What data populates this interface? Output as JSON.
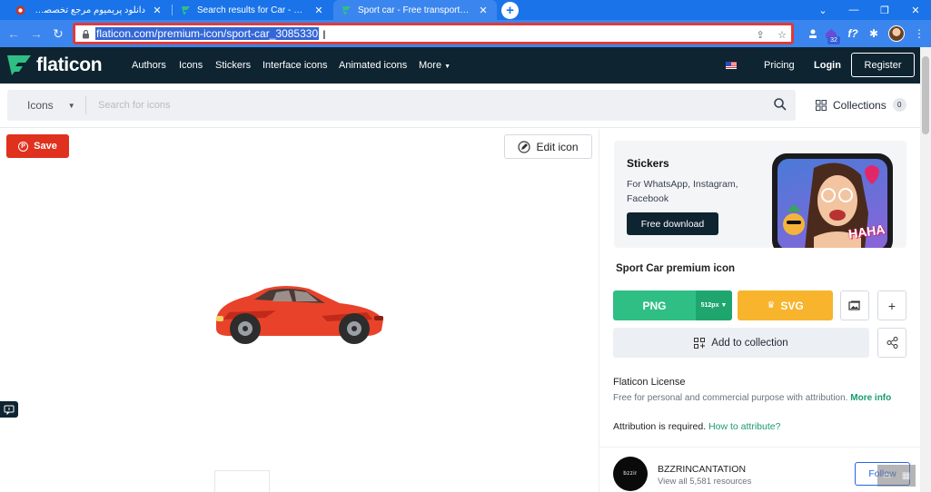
{
  "browser": {
    "tabs": [
      {
        "title": "دانلود پریمیوم مرجع تخصصی دانلود",
        "active": false
      },
      {
        "title": "Search results for Car - Flaticon",
        "active": false
      },
      {
        "title": "Sport car - Free transport icons",
        "active": true
      }
    ],
    "url": "flaticon.com/premium-icon/sport-car_3085330",
    "extension_badge": "32"
  },
  "header": {
    "logo_text": "flaticon",
    "nav": [
      "Authors",
      "Icons",
      "Stickers",
      "Interface icons",
      "Animated icons",
      "More"
    ],
    "pricing": "Pricing",
    "login": "Login",
    "register": "Register"
  },
  "search": {
    "type": "Icons",
    "placeholder": "Search for icons",
    "collections_label": "Collections",
    "collections_count": "0"
  },
  "left": {
    "save": "Save",
    "edit_icon": "Edit icon"
  },
  "promo": {
    "title": "Stickers",
    "desc": "For WhatsApp, Instagram, Facebook",
    "button": "Free download",
    "sticker_text": "HAHA"
  },
  "detail": {
    "title": "Sport Car premium icon",
    "png": "PNG",
    "png_size": "512px",
    "svg": "SVG",
    "add_to_collection": "Add to collection",
    "license_title": "Flaticon License",
    "license_desc": "Free for personal and commercial purpose with attribution.",
    "license_more": "More info",
    "attribution": "Attribution is required.",
    "attribution_link": "How to attribute?"
  },
  "author": {
    "avatar_text": "bzzir",
    "name": "BZZRINCANTATION",
    "resources": "View all 5,581 resources",
    "follow": "Follow"
  },
  "colors": {
    "chrome_blue": "#1a73e8",
    "header_dark": "#0e2431",
    "png_green": "#2fbf85",
    "svg_orange": "#f7b42c",
    "save_red": "#e0301e",
    "car_red": "#e8432a"
  }
}
